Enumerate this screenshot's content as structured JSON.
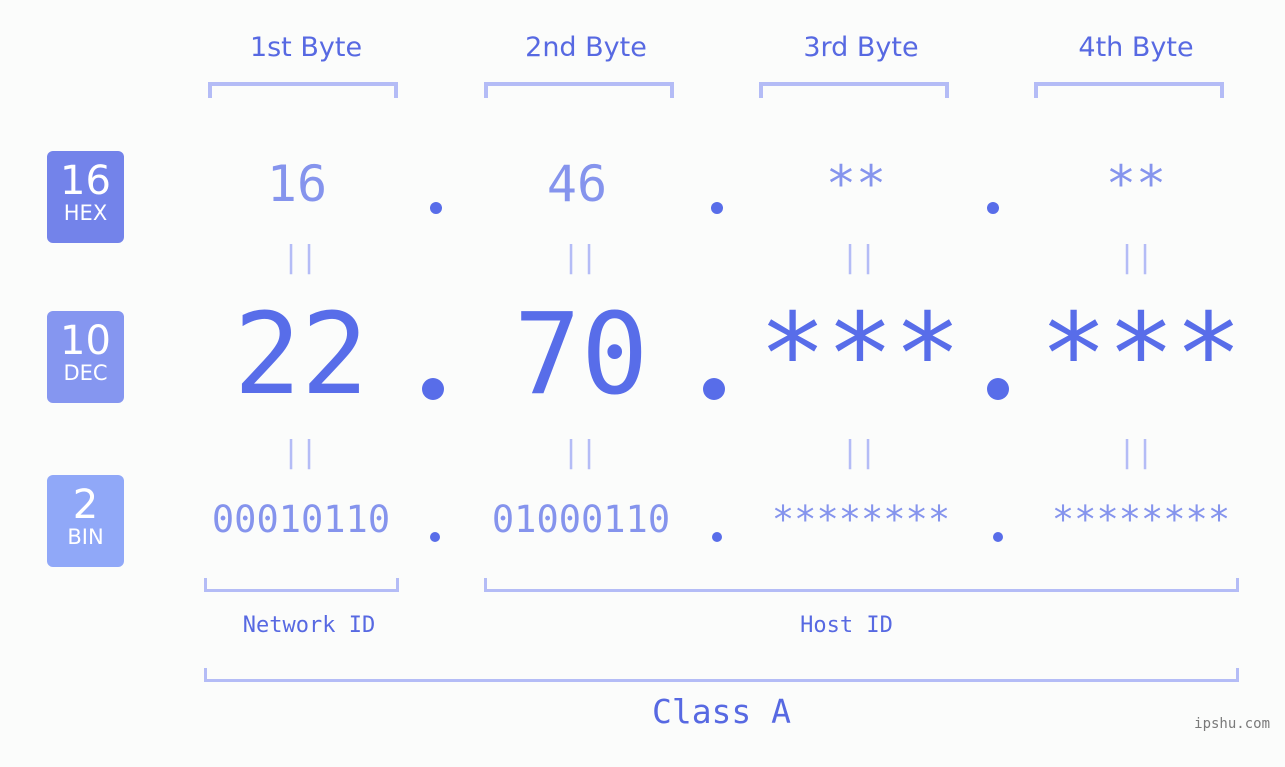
{
  "badges": [
    {
      "number": "16",
      "label": "HEX",
      "color": "#7383ea"
    },
    {
      "number": "10",
      "label": "DEC",
      "color": "#8596f0"
    },
    {
      "number": "2",
      "label": "BIN",
      "color": "#90a8f8"
    }
  ],
  "byte_headers": [
    "1st Byte",
    "2nd Byte",
    "3rd Byte",
    "4th Byte"
  ],
  "hex": [
    "16",
    "46",
    "**",
    "**"
  ],
  "dec": [
    "22",
    "70",
    "***",
    "***"
  ],
  "bin": [
    "00010110",
    "01000110",
    "********",
    "********"
  ],
  "equals_glyph": "||",
  "separator": ".",
  "network_id_label": "Network ID",
  "host_id_label": "Host ID",
  "class_label": "Class A",
  "watermark": "ipshu.com",
  "colors": {
    "primary": "#586de9",
    "secondary": "#8594ed",
    "bracket": "#b4bcf6",
    "background": "#fbfcfb"
  }
}
